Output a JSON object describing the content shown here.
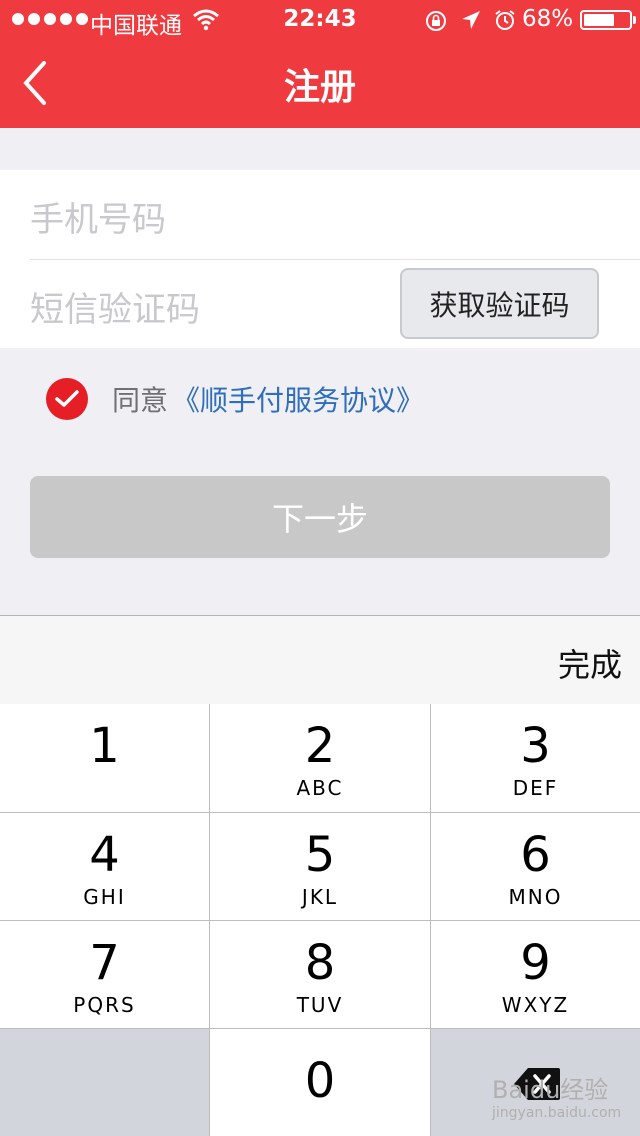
{
  "status_bar": {
    "carrier": "中国联通",
    "time": "22:43",
    "battery": "68%",
    "battery_level": 0.68,
    "icons": [
      "wifi-icon",
      "rotation-lock-icon",
      "location-icon",
      "alarm-icon",
      "battery-icon"
    ]
  },
  "nav": {
    "title": "注册",
    "back_icon": "chevron-left-icon"
  },
  "form": {
    "phone_placeholder": "手机号码",
    "code_placeholder": "短信验证码",
    "get_code_label": "获取验证码"
  },
  "agreement": {
    "checked": true,
    "prefix": "同意",
    "link": "《顺手付服务协议》"
  },
  "next_button": "下一步",
  "keyboard": {
    "done_label": "完成",
    "keys": [
      {
        "num": "1",
        "letters": ""
      },
      {
        "num": "2",
        "letters": "ABC"
      },
      {
        "num": "3",
        "letters": "DEF"
      },
      {
        "num": "4",
        "letters": "GHI"
      },
      {
        "num": "5",
        "letters": "JKL"
      },
      {
        "num": "6",
        "letters": "MNO"
      },
      {
        "num": "7",
        "letters": "PQRS"
      },
      {
        "num": "8",
        "letters": "TUV"
      },
      {
        "num": "9",
        "letters": "WXYZ"
      },
      {
        "num": "0",
        "letters": ""
      }
    ],
    "delete_icon": "backspace-icon"
  },
  "watermark": {
    "brand": "Baidu经验",
    "url": "jingyan.baidu.com"
  },
  "colors": {
    "brand_red": "#ef3b3f",
    "check_red": "#e51f25",
    "link_blue": "#2f6ebd",
    "disabled_gray": "#c8c8c8"
  }
}
